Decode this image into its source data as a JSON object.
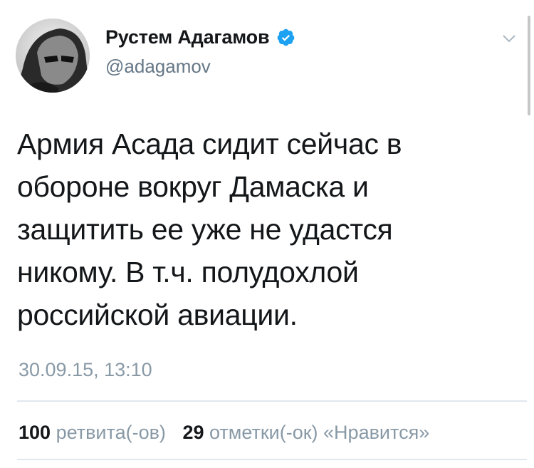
{
  "author": {
    "display_name": "Рустем Адагамов",
    "handle": "@adagamov",
    "verified": true
  },
  "tweet": {
    "text": "Армия Асада сидит сейчас в\nобороне вокруг Дамаска и\nзащитить ее уже не удастся\nникому. В т.ч. полудохлой\nроссийской авиации.",
    "timestamp": "30.09.15, 13:10"
  },
  "stats": {
    "retweets_count": "100",
    "retweets_label": "ретвита(-ов)",
    "likes_count": "29",
    "likes_label": "отметки(-ок) «Нравится»"
  },
  "icons": {
    "verified": "verified-badge-icon",
    "menu": "chevron-down-icon"
  },
  "colors": {
    "verified_blue": "#1da1f2",
    "secondary_text": "#8899a6",
    "divider": "#e1e8ed"
  }
}
